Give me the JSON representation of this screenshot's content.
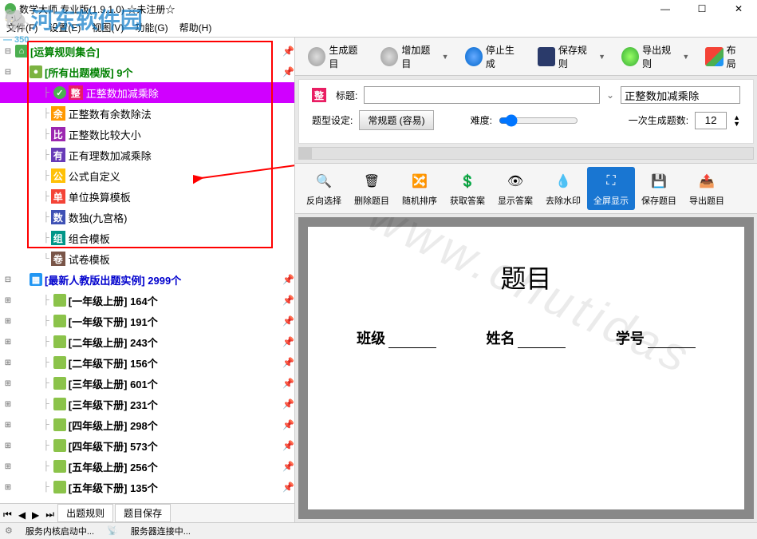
{
  "window": {
    "title": "数学大师 专业版(1.9.1.0) ☆未注册☆",
    "min": "—",
    "max": "☐",
    "close": "✕"
  },
  "watermark": {
    "main": "河东软件园",
    "sub": "— 350"
  },
  "menu": [
    "文件(F)",
    "设置(E)",
    "视图(V)",
    "功能(G)",
    "帮助(H)"
  ],
  "tree": {
    "root": "[运算规则集合]",
    "templates": {
      "label": "[所有出题模版]",
      "count": "9个",
      "items": [
        {
          "badge": "整",
          "cls": "b-zheng",
          "label": "正整数加减乘除",
          "sel": true
        },
        {
          "badge": "余",
          "cls": "b-yu",
          "label": "正整数有余数除法"
        },
        {
          "badge": "比",
          "cls": "b-bi",
          "label": "正整数比较大小"
        },
        {
          "badge": "有",
          "cls": "b-you",
          "label": "正有理数加减乘除"
        },
        {
          "badge": "公",
          "cls": "b-gong",
          "label": "公式自定义"
        },
        {
          "badge": "单",
          "cls": "b-dan",
          "label": "单位换算模板"
        },
        {
          "badge": "数",
          "cls": "b-shu",
          "label": "数独(九宫格)"
        },
        {
          "badge": "组",
          "cls": "b-zu",
          "label": "组合模板"
        },
        {
          "badge": "卷",
          "cls": "b-juan",
          "label": "试卷模板"
        }
      ]
    },
    "examples": {
      "label": "[最新人教版出题实例]",
      "count": "2999个",
      "items": [
        {
          "label": "[一年级上册]",
          "count": "164个"
        },
        {
          "label": "[一年级下册]",
          "count": "191个"
        },
        {
          "label": "[二年级上册]",
          "count": "243个"
        },
        {
          "label": "[二年级下册]",
          "count": "156个"
        },
        {
          "label": "[三年级上册]",
          "count": "601个"
        },
        {
          "label": "[三年级下册]",
          "count": "231个"
        },
        {
          "label": "[四年级上册]",
          "count": "298个"
        },
        {
          "label": "[四年级下册]",
          "count": "573个"
        },
        {
          "label": "[五年级上册]",
          "count": "256个"
        },
        {
          "label": "[五年级下册]",
          "count": "135个"
        }
      ]
    }
  },
  "tabs": {
    "t1": "出题规则",
    "t2": "题目保存"
  },
  "toolbar1": [
    {
      "label": "生成题目",
      "icn": "gray"
    },
    {
      "label": "增加题目",
      "icn": "gray",
      "drop": true
    },
    {
      "label": "停止生成",
      "icn": "blue"
    },
    {
      "label": "保存规则",
      "icn": "save",
      "drop": true
    },
    {
      "label": "导出规则",
      "icn": "green",
      "drop": true
    },
    {
      "label": "布局",
      "icn": "multi"
    }
  ],
  "settings": {
    "titleLabel": "标题:",
    "titleBadge": "整",
    "titleValue": "正整数加减乘除",
    "typeLabel": "题型设定:",
    "typeBtn": "常规题 (容易)",
    "diffLabel": "难度:",
    "countLabel": "一次生成题数:",
    "countValue": "12"
  },
  "toolbar2": [
    {
      "label": "反向选择",
      "glyph": "🔍"
    },
    {
      "label": "删除题目",
      "glyph": "🗑"
    },
    {
      "label": "随机排序",
      "glyph": "🔀"
    },
    {
      "label": "获取答案",
      "glyph": "💲"
    },
    {
      "label": "显示答案",
      "glyph": "👁"
    },
    {
      "label": "去除水印",
      "glyph": "💧"
    },
    {
      "label": "全屏显示",
      "glyph": "⛶",
      "active": true
    },
    {
      "label": "保存题目",
      "glyph": "💾"
    },
    {
      "label": "导出题目",
      "glyph": "📤"
    }
  ],
  "paper": {
    "title": "题目",
    "f1": "班级",
    "f2": "姓名",
    "f3": "学号",
    "watermark": "www.chutidas"
  },
  "status": {
    "s1": "服务内核启动中...",
    "s2": "服务器连接中..."
  }
}
